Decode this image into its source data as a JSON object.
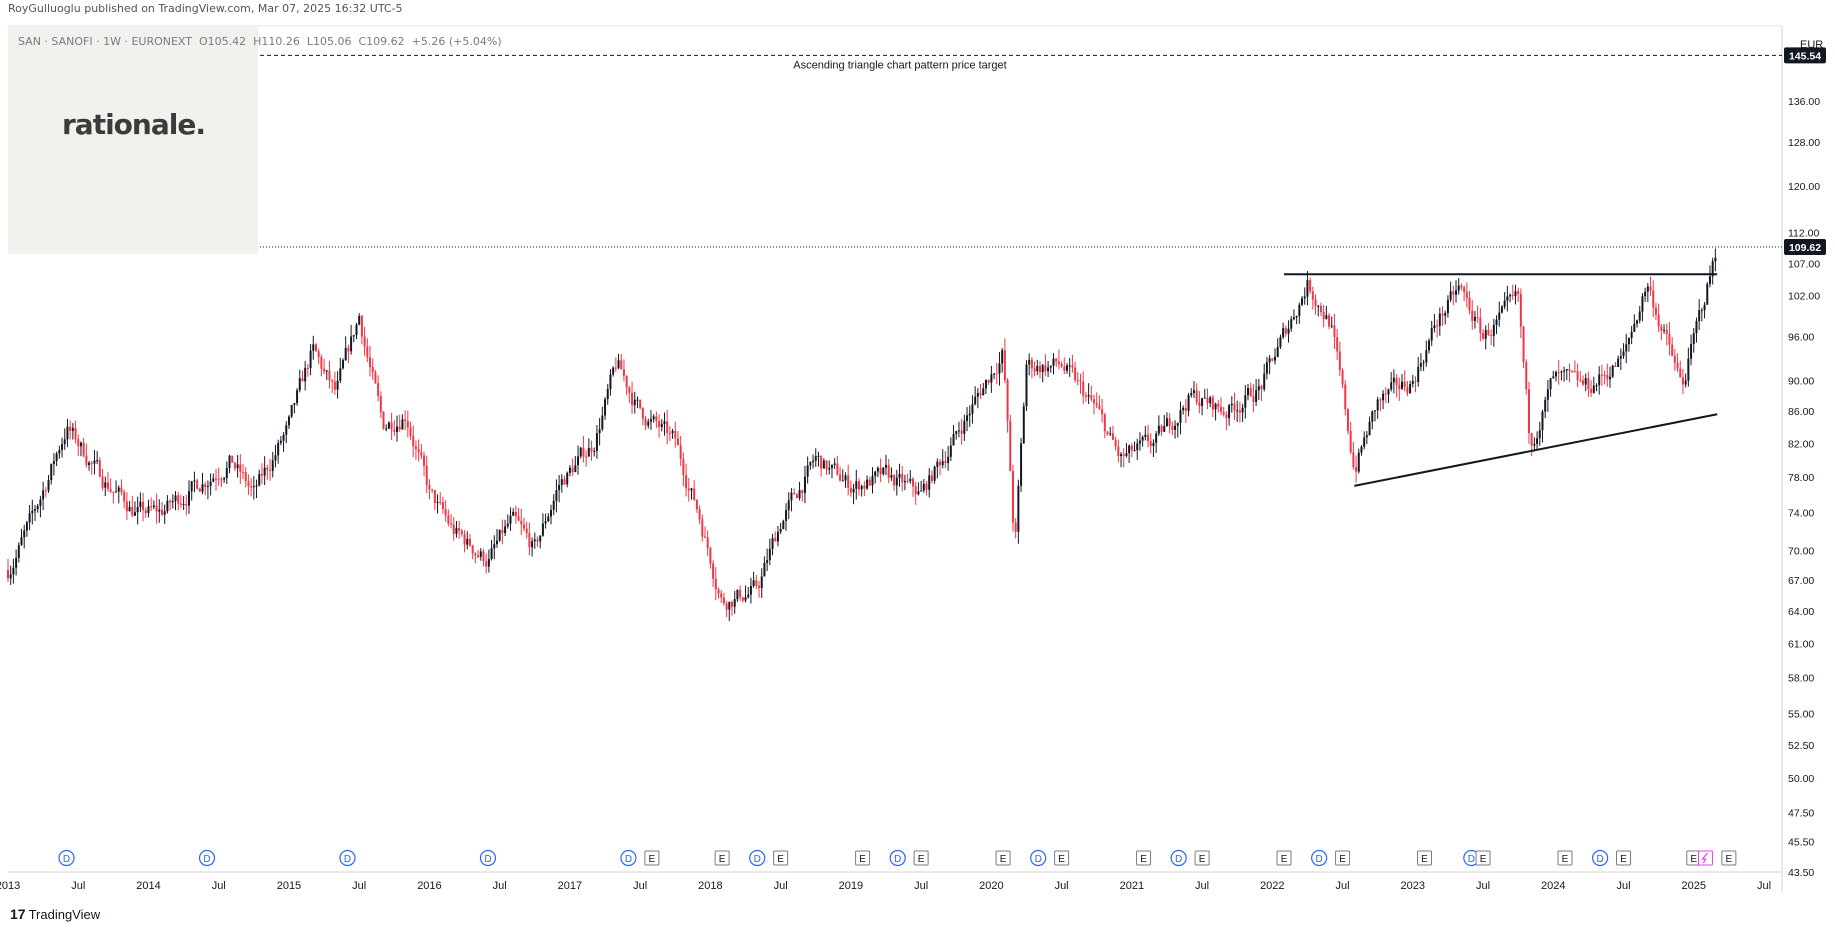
{
  "header": {
    "published": "RoyGulluoglu published on TradingView.com, Mar 07, 2025 16:32 UTC-5"
  },
  "symbol_line": "SAN · SANOFI · 1W · EURONEXT  O105.42  H110.26  L105.06  C109.62  +5.26 (+5.04%)",
  "logo": {
    "text": "rationale."
  },
  "footer": {
    "brand": "TradingView",
    "mark": "17"
  },
  "colors": {
    "up": "#131722",
    "down": "#f23645",
    "dividend": "#2962ff",
    "earnings": "#787b86",
    "split": "#e040fb"
  },
  "chart_data": {
    "type": "candlestick",
    "currency": "EUR",
    "last_price": "109.62",
    "target_price": "145.54",
    "target_label": "Ascending triangle chart pattern price target",
    "ylim": [
      43.5,
      152
    ],
    "scale": "log",
    "y_ticks": [
      "43.50",
      "45.50",
      "47.50",
      "50.00",
      "52.50",
      "55.00",
      "58.00",
      "61.00",
      "64.00",
      "67.00",
      "70.00",
      "74.00",
      "78.00",
      "82.00",
      "86.00",
      "90.00",
      "96.00",
      "102.00",
      "107.00",
      "112.00",
      "120.00",
      "128.00",
      "136.00"
    ],
    "x_ticks": [
      "2013",
      "Jul",
      "2014",
      "Jul",
      "2015",
      "Jul",
      "2016",
      "Jul",
      "2017",
      "Jul",
      "2018",
      "Jul",
      "2019",
      "Jul",
      "2020",
      "Jul",
      "2021",
      "Jul",
      "2022",
      "Jul",
      "2023",
      "Jul",
      "2024",
      "Jul",
      "2025",
      "Jul"
    ],
    "x_range": [
      "2013-01",
      "2025-07"
    ],
    "price_path": [
      [
        "2013-01",
        68
      ],
      [
        "2013-03",
        73
      ],
      [
        "2013-06",
        84
      ],
      [
        "2013-09",
        78
      ],
      [
        "2013-12",
        74
      ],
      [
        "2014-02",
        74
      ],
      [
        "2014-05",
        77
      ],
      [
        "2014-08",
        80
      ],
      [
        "2014-10",
        76
      ],
      [
        "2015-01",
        84
      ],
      [
        "2015-03",
        94
      ],
      [
        "2015-05",
        88
      ],
      [
        "2015-07",
        99
      ],
      [
        "2015-09",
        84
      ],
      [
        "2015-11",
        86
      ],
      [
        "2016-01",
        76
      ],
      [
        "2016-03",
        72
      ],
      [
        "2016-06",
        69
      ],
      [
        "2016-08",
        73
      ],
      [
        "2016-10",
        70
      ],
      [
        "2016-12",
        77
      ],
      [
        "2017-03",
        82
      ],
      [
        "2017-05",
        92
      ],
      [
        "2017-07",
        86
      ],
      [
        "2017-10",
        82
      ],
      [
        "2017-12",
        74
      ],
      [
        "2018-02",
        65
      ],
      [
        "2018-05",
        66
      ],
      [
        "2018-07",
        73
      ],
      [
        "2018-10",
        80
      ],
      [
        "2019-01",
        77
      ],
      [
        "2019-04",
        78
      ],
      [
        "2019-07",
        76
      ],
      [
        "2019-10",
        83
      ],
      [
        "2020-02",
        94
      ],
      [
        "2020-03",
        70
      ],
      [
        "2020-04",
        92
      ],
      [
        "2020-07",
        92
      ],
      [
        "2020-10",
        86
      ],
      [
        "2020-12",
        80
      ],
      [
        "2021-03",
        82
      ],
      [
        "2021-06",
        88
      ],
      [
        "2021-09",
        86
      ],
      [
        "2021-12",
        89
      ],
      [
        "2022-04",
        104
      ],
      [
        "2022-06",
        98
      ],
      [
        "2022-08",
        79
      ],
      [
        "2022-10",
        87
      ],
      [
        "2023-01",
        90
      ],
      [
        "2023-03",
        98
      ],
      [
        "2023-05",
        103
      ],
      [
        "2023-07",
        96
      ],
      [
        "2023-10",
        101
      ],
      [
        "2023-11",
        82
      ],
      [
        "2024-01",
        90
      ],
      [
        "2024-04",
        89
      ],
      [
        "2024-07",
        93
      ],
      [
        "2024-09",
        104
      ],
      [
        "2024-12",
        89
      ],
      [
        "2025-03",
        109.6
      ]
    ],
    "overlays": [
      {
        "type": "hline",
        "name": "resistance",
        "y": 105.3,
        "from": "2022-02",
        "to": "2025-03"
      },
      {
        "type": "trendline",
        "name": "rising-support",
        "from": [
          "2022-08",
          77.0
        ],
        "to": [
          "2025-03",
          85.6
        ]
      }
    ],
    "events": [
      {
        "t": "D",
        "d": "2013-06"
      },
      {
        "t": "D",
        "d": "2014-06"
      },
      {
        "t": "D",
        "d": "2015-06"
      },
      {
        "t": "D",
        "d": "2016-06"
      },
      {
        "t": "D",
        "d": "2017-06"
      },
      {
        "t": "E",
        "d": "2017-08"
      },
      {
        "t": "E",
        "d": "2018-02"
      },
      {
        "t": "D",
        "d": "2018-05"
      },
      {
        "t": "E",
        "d": "2018-07"
      },
      {
        "t": "E",
        "d": "2019-02"
      },
      {
        "t": "D",
        "d": "2019-05"
      },
      {
        "t": "E",
        "d": "2019-07"
      },
      {
        "t": "E",
        "d": "2020-02"
      },
      {
        "t": "D",
        "d": "2020-05"
      },
      {
        "t": "E",
        "d": "2020-07"
      },
      {
        "t": "E",
        "d": "2021-02"
      },
      {
        "t": "D",
        "d": "2021-05"
      },
      {
        "t": "E",
        "d": "2021-07"
      },
      {
        "t": "E",
        "d": "2022-02"
      },
      {
        "t": "D",
        "d": "2022-05"
      },
      {
        "t": "E",
        "d": "2022-07"
      },
      {
        "t": "E",
        "d": "2023-02"
      },
      {
        "t": "D",
        "d": "2023-06"
      },
      {
        "t": "E",
        "d": "2023-07"
      },
      {
        "t": "E",
        "d": "2024-02"
      },
      {
        "t": "D",
        "d": "2024-05"
      },
      {
        "t": "E",
        "d": "2024-07"
      },
      {
        "t": "E",
        "d": "2025-01"
      },
      {
        "t": "S",
        "d": "2025-02"
      },
      {
        "t": "E",
        "d": "2025-04"
      }
    ]
  }
}
